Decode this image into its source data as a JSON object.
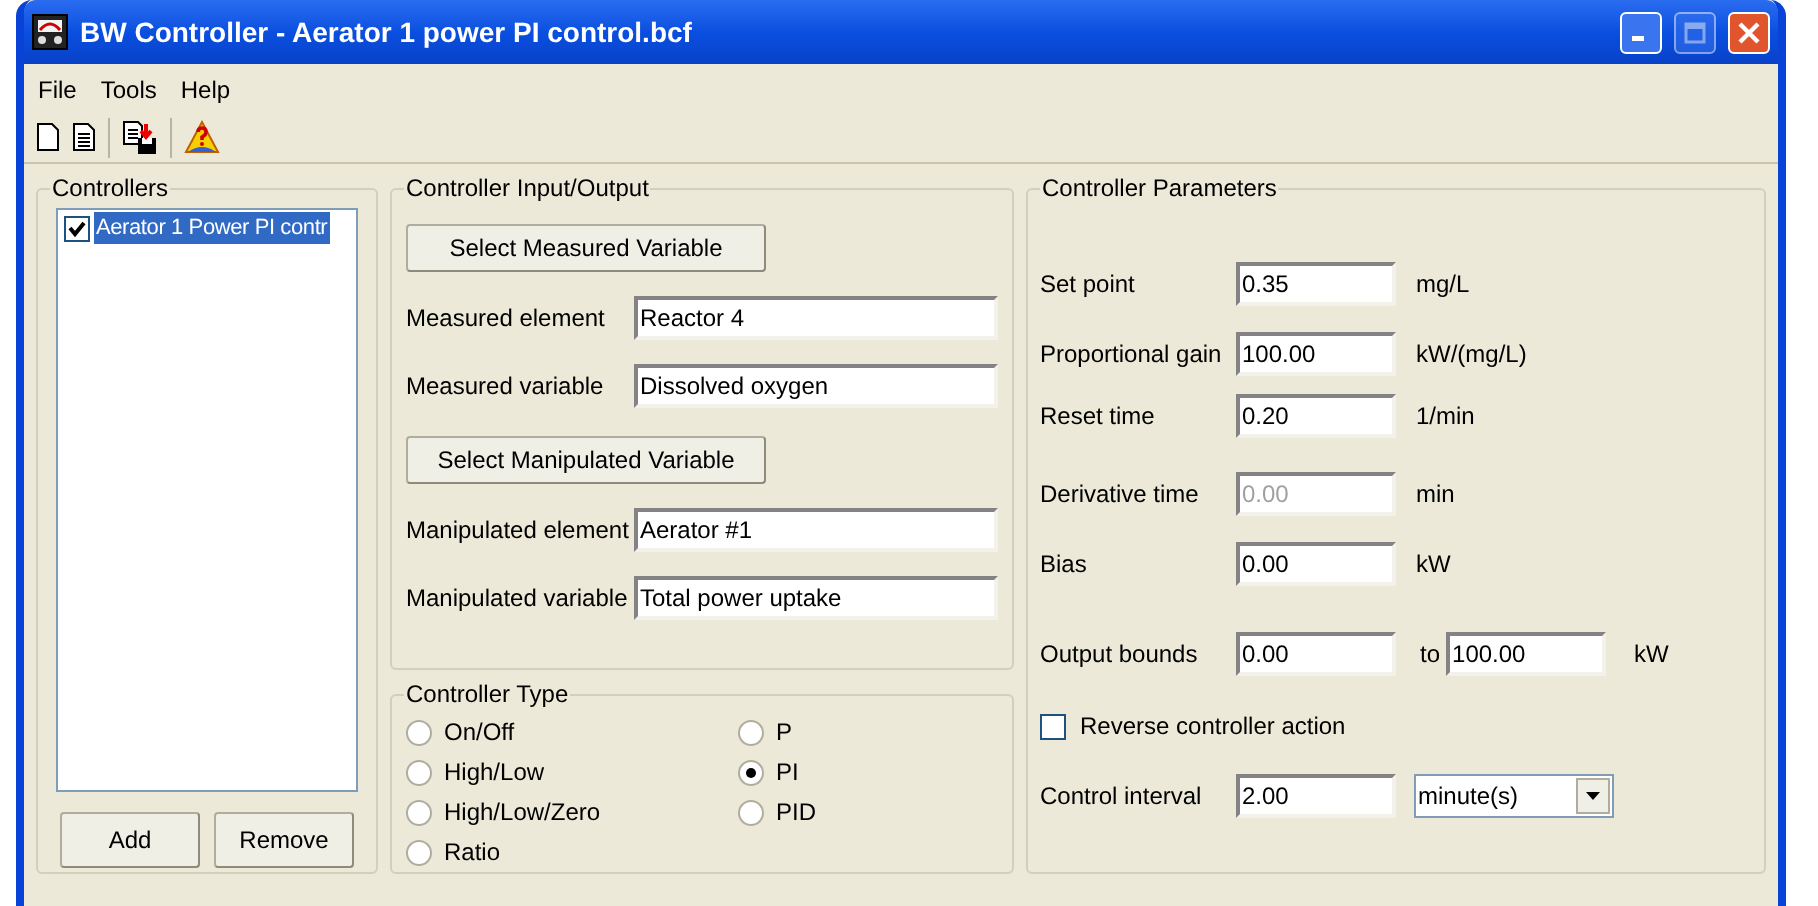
{
  "window": {
    "title": "BW Controller - Aerator 1 power PI control.bcf",
    "title_buttons": [
      {
        "kind": "minimize",
        "disabled": false
      },
      {
        "kind": "maximize",
        "disabled": true
      },
      {
        "kind": "close",
        "disabled": false
      }
    ]
  },
  "menu": [
    "File",
    "Tools",
    "Help"
  ],
  "controllers": {
    "title": "Controllers",
    "items": [
      {
        "label": "Aerator 1 Power PI contr",
        "checked": true,
        "selected": true
      }
    ],
    "buttons": [
      "Add",
      "Remove"
    ]
  },
  "io": {
    "title": "Controller Input/Output",
    "sections": [
      {
        "button": "Select Measured Variable",
        "fields": [
          {
            "label": "Measured element",
            "value": "Reactor 4"
          },
          {
            "label": "Measured variable",
            "value": "Dissolved oxygen"
          }
        ]
      },
      {
        "button": "Select Manipulated Variable",
        "fields": [
          {
            "label": "Manipulated element",
            "value": "Aerator #1"
          },
          {
            "label": "Manipulated variable",
            "value": "Total power uptake"
          }
        ]
      }
    ]
  },
  "controller_type": {
    "title": "Controller Type",
    "options": [
      {
        "label": "On/Off",
        "selected": false
      },
      {
        "label": "High/Low",
        "selected": false
      },
      {
        "label": "High/Low/Zero",
        "selected": false
      },
      {
        "label": "Ratio",
        "selected": false
      },
      {
        "label": "P",
        "selected": false
      },
      {
        "label": "PI",
        "selected": true
      },
      {
        "label": "PID",
        "selected": false
      }
    ]
  },
  "parameters": {
    "title": "Controller Parameters",
    "rows": [
      {
        "kind": "field",
        "label": "Set point",
        "value": "0.35",
        "unit": "mg/L",
        "disabled": false
      },
      {
        "kind": "field",
        "label": "Proportional gain",
        "value": "100.00",
        "unit": "kW/(mg/L)",
        "disabled": false
      },
      {
        "kind": "field",
        "label": "Reset time",
        "value": "0.20",
        "unit": "1/min",
        "disabled": false
      },
      {
        "kind": "field",
        "label": "Derivative time",
        "value": "0.00",
        "unit": "min",
        "disabled": true
      },
      {
        "kind": "field",
        "label": "Bias",
        "value": "0.00",
        "unit": "kW",
        "disabled": false
      },
      {
        "kind": "range",
        "label": "Output bounds",
        "value": "0.00",
        "separator": "to",
        "value_2": "100.00",
        "unit": "kW"
      },
      {
        "kind": "checkbox",
        "label": "Reverse controller action",
        "checked": false
      },
      {
        "kind": "select",
        "label": "Control interval",
        "value": "2.00",
        "option": "minute(s)"
      }
    ]
  }
}
